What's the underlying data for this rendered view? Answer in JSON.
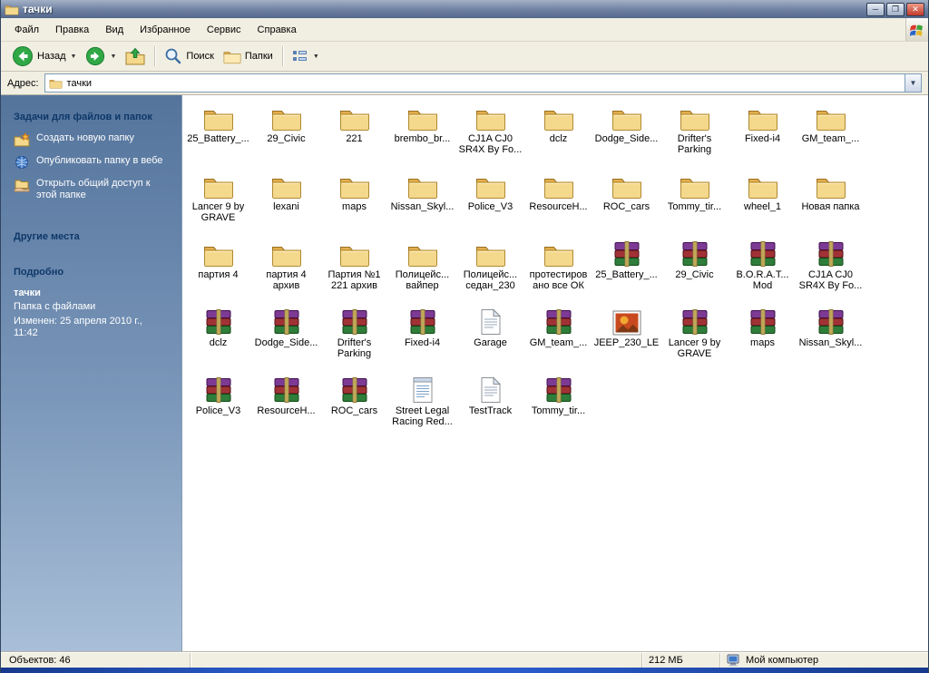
{
  "titlebar": {
    "title": "тачки"
  },
  "menu": {
    "items": [
      "Файл",
      "Правка",
      "Вид",
      "Избранное",
      "Сервис",
      "Справка"
    ]
  },
  "toolbar": {
    "back_label": "Назад",
    "search_label": "Поиск",
    "folders_label": "Папки"
  },
  "address": {
    "label": "Адрес:",
    "value": "тачки"
  },
  "sidebar": {
    "tasks": {
      "header": "Задачи для файлов и папок",
      "items": [
        {
          "label": "Создать новую папку",
          "icon": "new-folder-icon"
        },
        {
          "label": "Опубликовать папку в вебе",
          "icon": "publish-web-icon"
        },
        {
          "label": "Открыть общий доступ к этой папке",
          "icon": "share-folder-icon"
        }
      ]
    },
    "other_places": {
      "header": "Другие места"
    },
    "details": {
      "header": "Подробно",
      "name": "тачки",
      "type": "Папка с файлами",
      "modified": "Изменен: 25 апреля 2010 г., 11:42"
    }
  },
  "files": [
    {
      "name": "25_Battery_...",
      "type": "folder"
    },
    {
      "name": "29_Civic",
      "type": "folder"
    },
    {
      "name": "221",
      "type": "folder"
    },
    {
      "name": "brembo_br...",
      "type": "folder"
    },
    {
      "name": "CJ1A CJ0 SR4X By Fo...",
      "type": "folder"
    },
    {
      "name": "dclz",
      "type": "folder"
    },
    {
      "name": "Dodge_Side...",
      "type": "folder"
    },
    {
      "name": "Drifter's Parking",
      "type": "folder"
    },
    {
      "name": "Fixed-i4",
      "type": "folder"
    },
    {
      "name": "GM_team_...",
      "type": "folder"
    },
    {
      "name": "Lancer 9 by GRAVE",
      "type": "folder"
    },
    {
      "name": "lexani",
      "type": "folder"
    },
    {
      "name": "maps",
      "type": "folder"
    },
    {
      "name": "Nissan_Skyl...",
      "type": "folder"
    },
    {
      "name": "Police_V3",
      "type": "folder"
    },
    {
      "name": "ResourceH...",
      "type": "folder"
    },
    {
      "name": "ROC_cars",
      "type": "folder"
    },
    {
      "name": "Tommy_tir...",
      "type": "folder"
    },
    {
      "name": "wheel_1",
      "type": "folder"
    },
    {
      "name": "Новая папка",
      "type": "folder"
    },
    {
      "name": "партия 4",
      "type": "folder"
    },
    {
      "name": "партия 4 архив",
      "type": "folder"
    },
    {
      "name": "Партия №1 221 архив",
      "type": "folder"
    },
    {
      "name": "Полицейс... вайпер",
      "type": "folder"
    },
    {
      "name": "Полицейс... седан_230",
      "type": "folder"
    },
    {
      "name": "протестиров ано все ОК",
      "type": "folder"
    },
    {
      "name": "25_Battery_...",
      "type": "rar"
    },
    {
      "name": "29_Civic",
      "type": "rar"
    },
    {
      "name": "B.O.R.A.T... Mod",
      "type": "rar"
    },
    {
      "name": "CJ1A CJ0 SR4X By Fo...",
      "type": "rar"
    },
    {
      "name": "dclz",
      "type": "rar"
    },
    {
      "name": "Dodge_Side...",
      "type": "rar"
    },
    {
      "name": "Drifter's Parking",
      "type": "rar"
    },
    {
      "name": "Fixed-i4",
      "type": "rar"
    },
    {
      "name": "Garage",
      "type": "text"
    },
    {
      "name": "GM_team_...",
      "type": "rar"
    },
    {
      "name": "JEEP_230_LE",
      "type": "image"
    },
    {
      "name": "Lancer 9 by GRAVE",
      "type": "rar"
    },
    {
      "name": "maps",
      "type": "rar"
    },
    {
      "name": "Nissan_Skyl...",
      "type": "rar"
    },
    {
      "name": "Police_V3",
      "type": "rar"
    },
    {
      "name": "ResourceH...",
      "type": "rar"
    },
    {
      "name": "ROC_cars",
      "type": "rar"
    },
    {
      "name": "Street Legal Racing Red...",
      "type": "doc"
    },
    {
      "name": "TestTrack",
      "type": "text"
    },
    {
      "name": "Tommy_tir...",
      "type": "rar"
    }
  ],
  "statusbar": {
    "objects": "Объектов: 46",
    "size": "212 МБ",
    "location": "Мой компьютер"
  },
  "colors": {
    "folder_fill": "#F4D88C",
    "sidebar_top": "#54749C",
    "sidebar_bottom": "#A9BFD8",
    "titlebar": "#6E80A1",
    "taskbar_blue": "#2B5CCD"
  }
}
